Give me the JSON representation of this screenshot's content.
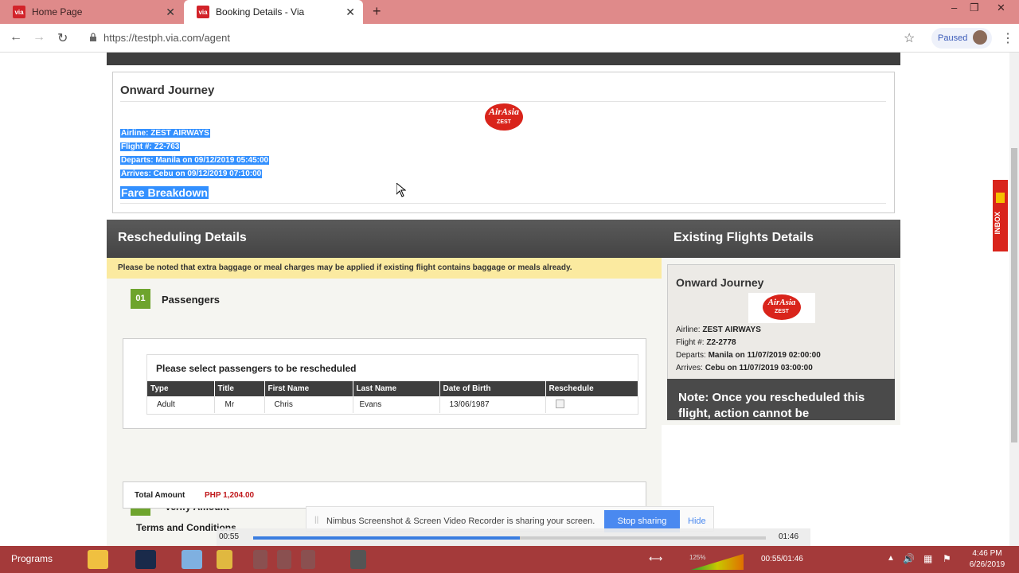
{
  "browser": {
    "tabs": [
      {
        "label": "Home Page",
        "favicon": "via"
      },
      {
        "label": "Booking Details - Via",
        "favicon": "via"
      }
    ],
    "url": "https://testph.via.com/agent",
    "paused_label": "Paused"
  },
  "onward": {
    "title": "Onward Journey",
    "logo_text": "AirAsia",
    "logo_sub": "ZEST",
    "airline": "Airline: ZEST AIRWAYS",
    "flight": "Flight #: Z2-763",
    "departs": "Departs: Manila on 09/12/2019 05:45:00",
    "arrives": "Arrives: Cebu on 09/12/2019 07:10:00",
    "fare_breakdown": "Fare Breakdown"
  },
  "rescheduling": {
    "heading": "Rescheduling Details",
    "notice": "Please be noted that extra baggage or meal charges may be applied if existing flight contains baggage or meals already.",
    "step1_num": "01",
    "step1_label": "Passengers",
    "passengers_title": "Please select passengers to be rescheduled",
    "columns": [
      "Type",
      "Title",
      "First Name",
      "Last Name",
      "Date of Birth",
      "Reschedule"
    ],
    "rows": [
      {
        "type": "Adult",
        "title": "Mr",
        "first": "Chris",
        "last": "Evans",
        "dob": "13/06/1987"
      }
    ],
    "step2_num": "02",
    "step2_label": "Verify Amount",
    "total_label": "Total Amount",
    "total_value": "PHP 1,204.00",
    "terms": "Terms and Conditions"
  },
  "existing": {
    "heading": "Existing Flights Details",
    "title": "Onward Journey",
    "airline_label": "Airline:",
    "airline_value": "ZEST AIRWAYS",
    "flight_label": "Flight #:",
    "flight_value": "Z2-2778",
    "departs_label": "Departs:",
    "departs_value": "Manila on 11/07/2019 02:00:00",
    "arrives_label": "Arrives:",
    "arrives_value": "Cebu on 11/07/2019 03:00:00",
    "note": "Note: Once you rescheduled this flight, action cannot be"
  },
  "inbox_label": "INBOX",
  "nimbus": {
    "text": "Nimbus Screenshot & Screen Video Recorder is sharing your screen.",
    "stop": "Stop sharing",
    "hide": "Hide"
  },
  "player": {
    "current": "00:55",
    "total": "01:46",
    "progress": 0.52,
    "media_time": "00:55/01:46",
    "volume": "125%"
  },
  "taskbar": {
    "programs": "Programs",
    "time": "4:46 PM",
    "date": "6/26/2019"
  }
}
